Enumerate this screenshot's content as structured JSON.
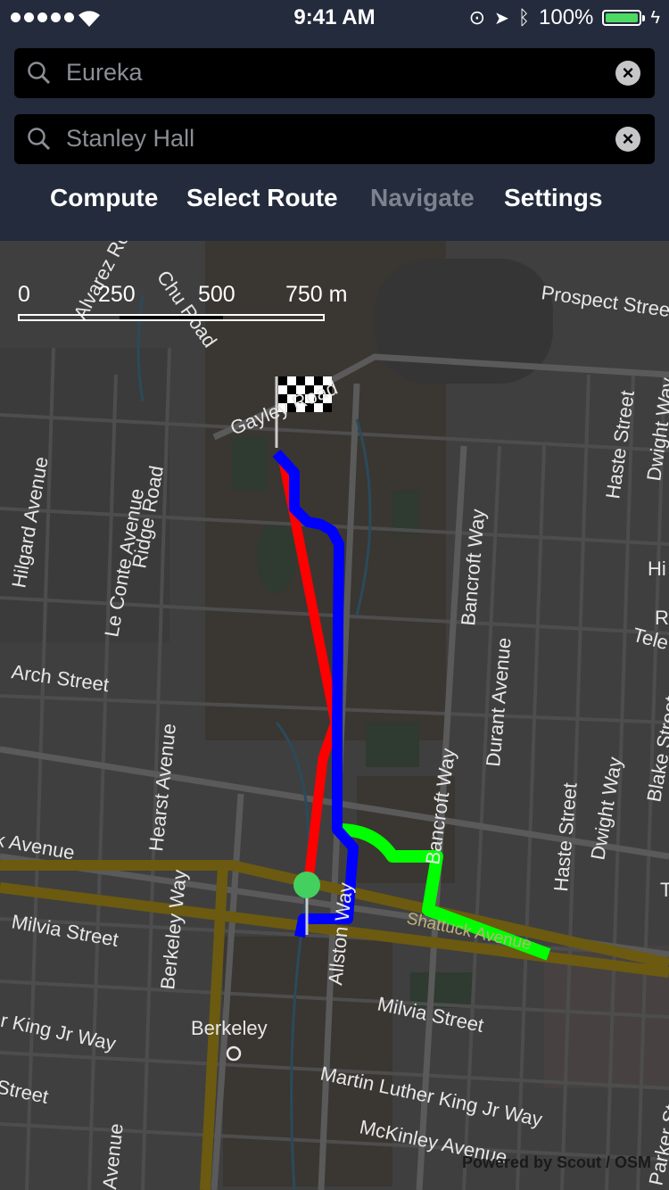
{
  "status_bar": {
    "time": "9:41 AM",
    "battery": "100%",
    "icons": [
      "signal-dots-icon",
      "wifi-icon",
      "orientation-lock-icon",
      "location-arrow-icon",
      "bluetooth-icon",
      "battery-icon",
      "charging-icon"
    ]
  },
  "search": {
    "origin_value": "Eureka",
    "destination_value": "Stanley Hall"
  },
  "toolbar": {
    "compute_label": "Compute",
    "select_route_label": "Select Route",
    "navigate_label": "Navigate",
    "settings_label": "Settings"
  },
  "map": {
    "scale": [
      "0",
      "250",
      "500",
      "750 m"
    ],
    "streets": {
      "alvarez": "Alvarez Road",
      "chu": "Chu Road",
      "prospect": "Prospect Street",
      "gayley": "Gayley Road",
      "hilgard": "Hilgard Avenue",
      "leconte": "Le Conte Avenue",
      "ridge": "Ridge Road",
      "bancroft1": "Bancroft Way",
      "haste1": "Haste Street",
      "dwight1": "Dwight Way",
      "arch": "Arch Street",
      "hearst": "Hearst Avenue",
      "durant": "Durant Avenue",
      "bancroft2": "Bancroft Way",
      "haste2": "Haste Street",
      "dwight2": "Dwight Way",
      "blake": "Blake Street",
      "shattuck1": "Shattuck Avenue",
      "milvia1": "Milvia Street",
      "berkeley_way": "Berkeley Way",
      "shattuck2": "Shattuck Avenue",
      "allston": "Allston Way",
      "milvia2": "Milvia Street",
      "mlk1": "Martin Luther King Jr Way",
      "berkeley": "Berkeley",
      "mlk2": "Martin Luther King Jr Way",
      "mckinley": "McKinley Avenue",
      "street_left": "Street",
      "avenue_left": "Avenue",
      "parker": "Parker Street",
      "edge_hi": "Hi",
      "edge_r": "R",
      "edge_tele": "Tele",
      "edge_t": "T",
      "edge_dwight": "Dwight Way"
    },
    "route_colors": {
      "route_a": "#0000ff",
      "route_b": "#ff0000",
      "route_c": "#00ff00",
      "transit": "#6b5a10",
      "start": "#44d05e"
    },
    "attribution": "Powered by Scout / OSM"
  }
}
